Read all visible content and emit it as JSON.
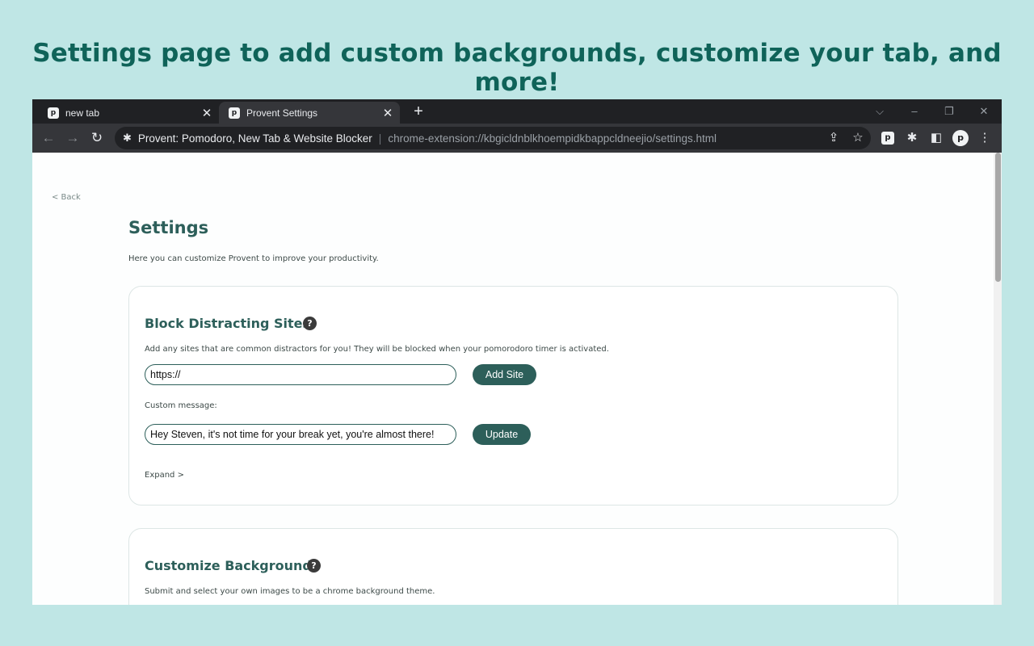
{
  "headline": "Settings page to add custom backgrounds, customize your tab, and more!",
  "browser": {
    "tabs": [
      {
        "favicon": "p",
        "title": "new tab",
        "close": "✕"
      },
      {
        "favicon": "p",
        "title": "Provent Settings",
        "close": "✕"
      }
    ],
    "new_tab": "+",
    "window_controls": {
      "tab_search": "⌵",
      "minimize": "–",
      "restore": "❐",
      "close": "✕"
    },
    "toolbar": {
      "back": "←",
      "forward": "→",
      "reload": "↻",
      "omnibox_icon": "puzzle-icon",
      "site_name": "Provent: Pomodoro, New Tab & Website Blocker",
      "separator": "|",
      "url": "chrome-extension://kbgicldnblkhoempidkbappcldneejio/settings.html",
      "share": "⇪",
      "bookmark": "☆",
      "extension_badge": "p",
      "extensions": "✱",
      "side_panel": "◧",
      "profile": "p",
      "menu": "⋮"
    }
  },
  "page": {
    "back_link": "< Back",
    "title": "Settings",
    "subtitle": "Here you can customize Provent to improve your productivity.",
    "block_sites": {
      "title": "Block Distracting Sites",
      "help": "?",
      "description": "Add any sites that are common distractors for you! They will be blocked when your pomorodoro timer is activated.",
      "site_input_value": "https://",
      "add_button": "Add Site",
      "custom_message_label": "Custom message:",
      "custom_message_value": "Hey Steven, it's not time for your break yet, you're almost there!",
      "update_button": "Update",
      "expand_link": "Expand >"
    },
    "background": {
      "title": "Customize Background",
      "help": "?",
      "description": "Submit and select your own images to be a chrome background theme."
    }
  },
  "colors": {
    "background": "#bfe6e5",
    "headline": "#0f6359",
    "accent": "#2d5f5a",
    "browser_dark": "#202124",
    "toolbar": "#35363a"
  }
}
